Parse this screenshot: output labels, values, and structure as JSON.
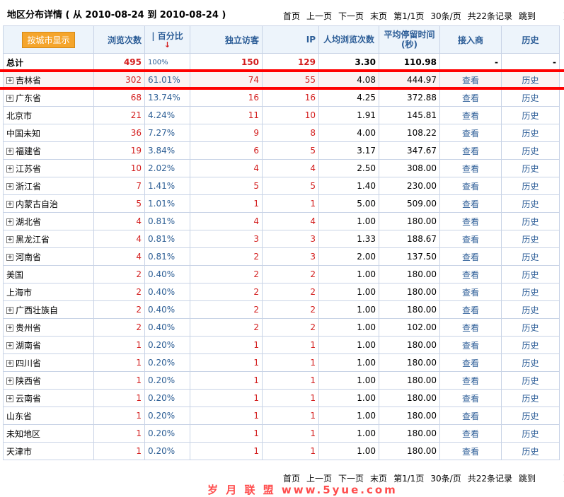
{
  "page": {
    "title": "地区分布详情 ( 从 2010-08-24 到 2010-08-24 )",
    "pager": {
      "first": "首页",
      "prev": "上一页",
      "next": "下一页",
      "last": "末页",
      "page_info": "第1/1页",
      "per_page": "30条/页",
      "total": "共22条记录",
      "jump": "跳到",
      "unit": "页"
    }
  },
  "columns": {
    "group_button": "按城市显示",
    "views": "浏览次数",
    "percent": "| 百分比",
    "visitors": "独立访客",
    "ip": "IP",
    "avg_views": "人均浏览次数",
    "avg_stay": "平均停留时间(秒)",
    "isp": "接入商",
    "history": "历史"
  },
  "summary": {
    "label": "总计",
    "views": "495",
    "percent": "100%",
    "visitors": "150",
    "ip": "129",
    "avg_views": "3.30",
    "avg_stay": "110.98",
    "isp": "-",
    "history": "-"
  },
  "rows": [
    {
      "region": "吉林省",
      "views": "302",
      "percent": "61.01%",
      "visitors": "74",
      "ip": "55",
      "avg_views": "4.08",
      "avg_stay": "444.97",
      "view": "查看",
      "history": "历史",
      "expandable": true
    },
    {
      "region": "广东省",
      "views": "68",
      "percent": "13.74%",
      "visitors": "16",
      "ip": "16",
      "avg_views": "4.25",
      "avg_stay": "372.88",
      "view": "查看",
      "history": "历史",
      "expandable": true
    },
    {
      "region": "北京市",
      "views": "21",
      "percent": "4.24%",
      "visitors": "11",
      "ip": "10",
      "avg_views": "1.91",
      "avg_stay": "145.81",
      "view": "查看",
      "history": "历史",
      "expandable": false
    },
    {
      "region": "中国未知",
      "views": "36",
      "percent": "7.27%",
      "visitors": "9",
      "ip": "8",
      "avg_views": "4.00",
      "avg_stay": "108.22",
      "view": "查看",
      "history": "历史",
      "expandable": false
    },
    {
      "region": "福建省",
      "views": "19",
      "percent": "3.84%",
      "visitors": "6",
      "ip": "5",
      "avg_views": "3.17",
      "avg_stay": "347.67",
      "view": "查看",
      "history": "历史",
      "expandable": true
    },
    {
      "region": "江苏省",
      "views": "10",
      "percent": "2.02%",
      "visitors": "4",
      "ip": "4",
      "avg_views": "2.50",
      "avg_stay": "308.00",
      "view": "查看",
      "history": "历史",
      "expandable": true
    },
    {
      "region": "浙江省",
      "views": "7",
      "percent": "1.41%",
      "visitors": "5",
      "ip": "5",
      "avg_views": "1.40",
      "avg_stay": "230.00",
      "view": "查看",
      "history": "历史",
      "expandable": true
    },
    {
      "region": "内蒙古自治",
      "views": "5",
      "percent": "1.01%",
      "visitors": "1",
      "ip": "1",
      "avg_views": "5.00",
      "avg_stay": "509.00",
      "view": "查看",
      "history": "历史",
      "expandable": true
    },
    {
      "region": "湖北省",
      "views": "4",
      "percent": "0.81%",
      "visitors": "4",
      "ip": "4",
      "avg_views": "1.00",
      "avg_stay": "180.00",
      "view": "查看",
      "history": "历史",
      "expandable": true
    },
    {
      "region": "黑龙江省",
      "views": "4",
      "percent": "0.81%",
      "visitors": "3",
      "ip": "3",
      "avg_views": "1.33",
      "avg_stay": "188.67",
      "view": "查看",
      "history": "历史",
      "expandable": true
    },
    {
      "region": "河南省",
      "views": "4",
      "percent": "0.81%",
      "visitors": "2",
      "ip": "3",
      "avg_views": "2.00",
      "avg_stay": "137.50",
      "view": "查看",
      "history": "历史",
      "expandable": true
    },
    {
      "region": "美国",
      "views": "2",
      "percent": "0.40%",
      "visitors": "2",
      "ip": "2",
      "avg_views": "1.00",
      "avg_stay": "180.00",
      "view": "查看",
      "history": "历史",
      "expandable": false
    },
    {
      "region": "上海市",
      "views": "2",
      "percent": "0.40%",
      "visitors": "2",
      "ip": "2",
      "avg_views": "1.00",
      "avg_stay": "180.00",
      "view": "查看",
      "history": "历史",
      "expandable": false
    },
    {
      "region": "广西壮族自",
      "views": "2",
      "percent": "0.40%",
      "visitors": "2",
      "ip": "2",
      "avg_views": "1.00",
      "avg_stay": "180.00",
      "view": "查看",
      "history": "历史",
      "expandable": true
    },
    {
      "region": "贵州省",
      "views": "2",
      "percent": "0.40%",
      "visitors": "2",
      "ip": "2",
      "avg_views": "1.00",
      "avg_stay": "102.00",
      "view": "查看",
      "history": "历史",
      "expandable": true
    },
    {
      "region": "湖南省",
      "views": "1",
      "percent": "0.20%",
      "visitors": "1",
      "ip": "1",
      "avg_views": "1.00",
      "avg_stay": "180.00",
      "view": "查看",
      "history": "历史",
      "expandable": true
    },
    {
      "region": "四川省",
      "views": "1",
      "percent": "0.20%",
      "visitors": "1",
      "ip": "1",
      "avg_views": "1.00",
      "avg_stay": "180.00",
      "view": "查看",
      "history": "历史",
      "expandable": true
    },
    {
      "region": "陕西省",
      "views": "1",
      "percent": "0.20%",
      "visitors": "1",
      "ip": "1",
      "avg_views": "1.00",
      "avg_stay": "180.00",
      "view": "查看",
      "history": "历史",
      "expandable": true
    },
    {
      "region": "云南省",
      "views": "1",
      "percent": "0.20%",
      "visitors": "1",
      "ip": "1",
      "avg_views": "1.00",
      "avg_stay": "180.00",
      "view": "查看",
      "history": "历史",
      "expandable": true
    },
    {
      "region": "山东省",
      "views": "1",
      "percent": "0.20%",
      "visitors": "1",
      "ip": "1",
      "avg_views": "1.00",
      "avg_stay": "180.00",
      "view": "查看",
      "history": "历史",
      "expandable": false
    },
    {
      "region": "未知地区",
      "views": "1",
      "percent": "0.20%",
      "visitors": "1",
      "ip": "1",
      "avg_views": "1.00",
      "avg_stay": "180.00",
      "view": "查看",
      "history": "历史",
      "expandable": false
    },
    {
      "region": "天津市",
      "views": "1",
      "percent": "0.20%",
      "visitors": "1",
      "ip": "1",
      "avg_views": "1.00",
      "avg_stay": "180.00",
      "view": "查看",
      "history": "历史",
      "expandable": false
    }
  ],
  "watermark": "岁 月 联 盟  www.5yue.com"
}
